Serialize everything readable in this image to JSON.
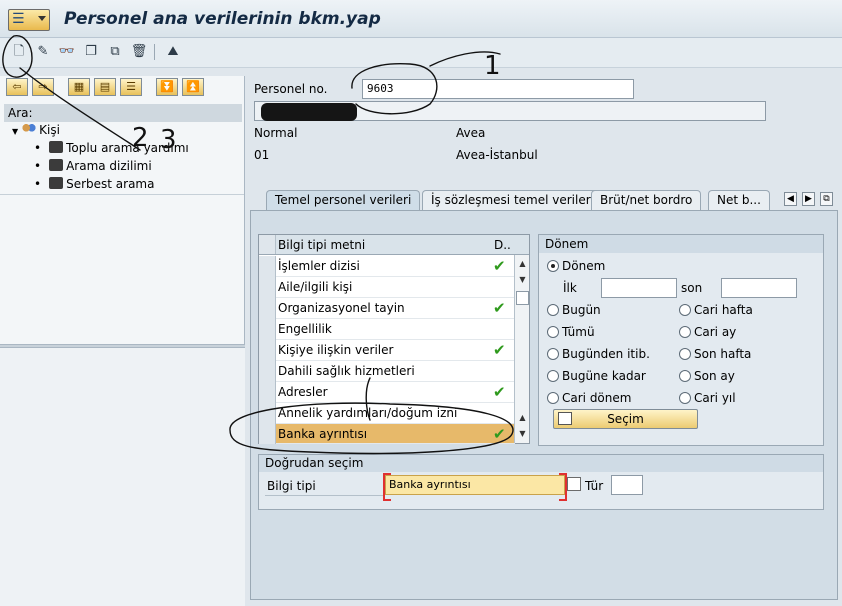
{
  "title_bar": {
    "title": "Personel ana verilerinin bkm.yap"
  },
  "toolbar": {
    "icons": [
      "create-icon",
      "change-icon",
      "display-icon",
      "copy-icon",
      "delimit-icon",
      "delete-icon",
      "overview-icon"
    ]
  },
  "left_panel": {
    "search_header": "Ara:",
    "tree_root": "Kişi",
    "tree_items": [
      "Toplu arama yardımı",
      "Arama dizilimi",
      "Serbest arama"
    ]
  },
  "header": {
    "personnel_no_label": "Personel no.",
    "personnel_no_value": "9603",
    "row1_col1": "Normal",
    "row1_col2": "Avea",
    "row2_col1": "01",
    "row2_col2": "Avea-İstanbul"
  },
  "tabs": [
    {
      "label": "Temel personel verileri",
      "active": true
    },
    {
      "label": "İş sözleşmesi temel verileri",
      "active": false
    },
    {
      "label": "Brüt/net bordro",
      "active": false
    },
    {
      "label": "Net b...",
      "active": false
    }
  ],
  "infotype_table": {
    "col_text": "Bilgi tipi metni",
    "col_status": "D..",
    "rows": [
      {
        "text": "İşlemler dizisi",
        "checked": true
      },
      {
        "text": "Aile/ilgili kişi",
        "checked": false
      },
      {
        "text": "Organizasyonel tayin",
        "checked": true
      },
      {
        "text": "Engellilik",
        "checked": false
      },
      {
        "text": "Kişiye ilişkin veriler",
        "checked": true
      },
      {
        "text": "Dahili sağlık hizmetleri",
        "checked": false
      },
      {
        "text": "Adresler",
        "checked": true
      },
      {
        "text": "Annelik yardımları/doğum izni",
        "checked": false
      },
      {
        "text": "Banka ayrıntısı",
        "checked": true,
        "selected": true
      }
    ]
  },
  "period": {
    "header": "Dönem",
    "period_option": "Dönem",
    "from_label": "İlk",
    "to_label": "son",
    "options_left": [
      "Bugün",
      "Tümü",
      "Bugünden itib.",
      "Bugüne kadar",
      "Cari dönem"
    ],
    "options_right": [
      "Cari hafta",
      "Cari ay",
      "Son hafta",
      "Son ay",
      "Cari yıl"
    ],
    "button": "Seçim"
  },
  "direct_selection": {
    "header": "Doğrudan seçim",
    "infotype_label": "Bilgi tipi",
    "infotype_value": "Banka ayrıntısı",
    "type_label": "Tür"
  },
  "annotations": {
    "note_1": "1",
    "note_2": "2",
    "note_3": "3"
  },
  "colors": {
    "selected_row": "#e7b96a",
    "check": "#2f9a1d",
    "annotation_ink": "#111111"
  }
}
